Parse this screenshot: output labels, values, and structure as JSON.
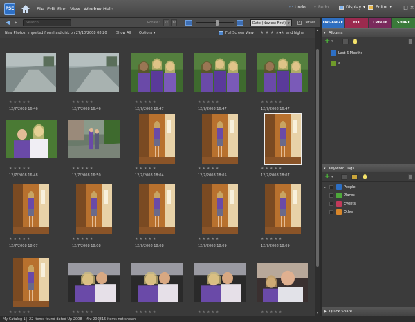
{
  "app": {
    "logo": "PSE"
  },
  "menu": [
    "File",
    "Edit",
    "Find",
    "View",
    "Window",
    "Help"
  ],
  "top_right": {
    "undo": "Undo",
    "redo": "Redo",
    "display": "Display",
    "editor": "Editor"
  },
  "toolbar": {
    "search_placeholder": "Search",
    "rotate_label": "Rotate:",
    "sort_value": "Date (Newest First)",
    "details_label": "Details"
  },
  "subbar": {
    "status": "New Photos: Imported from hard disk on 27/10/2008 08:20",
    "show_all": "Show All",
    "options": "Options",
    "full_screen": "Full Screen View",
    "rating_filter": "and higher"
  },
  "tabs": [
    {
      "label": "ORGANIZE",
      "color": "#2f6fc0"
    },
    {
      "label": "FIX",
      "color": "#9b2a4e"
    },
    {
      "label": "CREATE",
      "color": "#7a2a5c"
    },
    {
      "label": "SHARE",
      "color": "#3b7a3a"
    }
  ],
  "albums": {
    "title": "Albums",
    "items": [
      {
        "label": "Last 6 Months",
        "color": "#2d6fc4"
      },
      {
        "label": "a",
        "color": "#6f9a2a"
      }
    ]
  },
  "keyword_tags": {
    "title": "Keyword Tags",
    "items": [
      {
        "label": "People",
        "color": "#2d6fc4"
      },
      {
        "label": "Places",
        "color": "#4ea83a"
      },
      {
        "label": "Events",
        "color": "#c23a5a"
      },
      {
        "label": "Other",
        "color": "#d8862a"
      }
    ]
  },
  "quick_share": "Quick Share",
  "photos": [
    {
      "date": "12/7/2008 16:46",
      "kind": "street"
    },
    {
      "date": "12/7/2008 16:46",
      "kind": "street"
    },
    {
      "date": "12/7/2008 16:47",
      "kind": "girls"
    },
    {
      "date": "12/7/2008 16:47",
      "kind": "girls"
    },
    {
      "date": "12/7/2008 16:47",
      "kind": "girls"
    },
    {
      "date": "12/7/2008 16:48",
      "kind": "girls2"
    },
    {
      "date": "12/7/2008 16:50",
      "kind": "yard"
    },
    {
      "date": "12/7/2008 18:04",
      "kind": "portrait"
    },
    {
      "date": "12/7/2008 18:05",
      "kind": "portrait"
    },
    {
      "date": "12/7/2008 18:07",
      "kind": "portrait",
      "selected": true
    },
    {
      "date": "12/7/2008 18:07",
      "kind": "portrait"
    },
    {
      "date": "12/7/2008 18:08",
      "kind": "portrait"
    },
    {
      "date": "12/7/2008 18:08",
      "kind": "portrait"
    },
    {
      "date": "12/7/2008 18:09",
      "kind": "portrait"
    },
    {
      "date": "12/7/2008 18:09",
      "kind": "portrait"
    },
    {
      "date": "",
      "kind": "portrait"
    },
    {
      "date": "",
      "kind": "hug"
    },
    {
      "date": "",
      "kind": "hug"
    },
    {
      "date": "",
      "kind": "hug"
    },
    {
      "date": "",
      "kind": "man"
    }
  ],
  "status": {
    "catalog": "My Catalog 1",
    "found": "22 items found dated Up 2008 - Mrz 2008",
    "not_shown": "15 items not shown"
  }
}
